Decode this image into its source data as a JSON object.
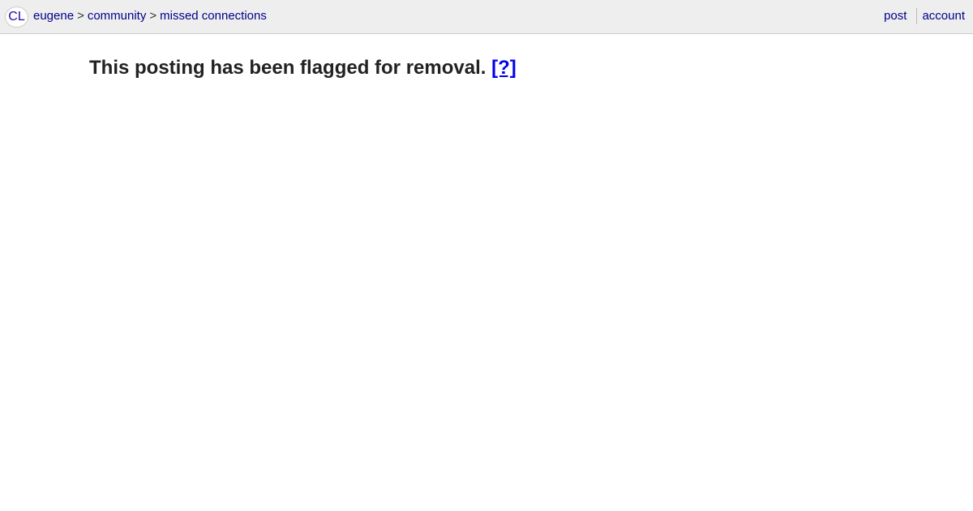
{
  "header": {
    "logo_text": "CL",
    "breadcrumb": {
      "city": "eugene",
      "separator": ">",
      "section": "community",
      "category": "missed connections"
    },
    "post_label": "post",
    "account_label": "account"
  },
  "main": {
    "message": "This posting has been flagged for removal.",
    "help_link": "[?]"
  }
}
